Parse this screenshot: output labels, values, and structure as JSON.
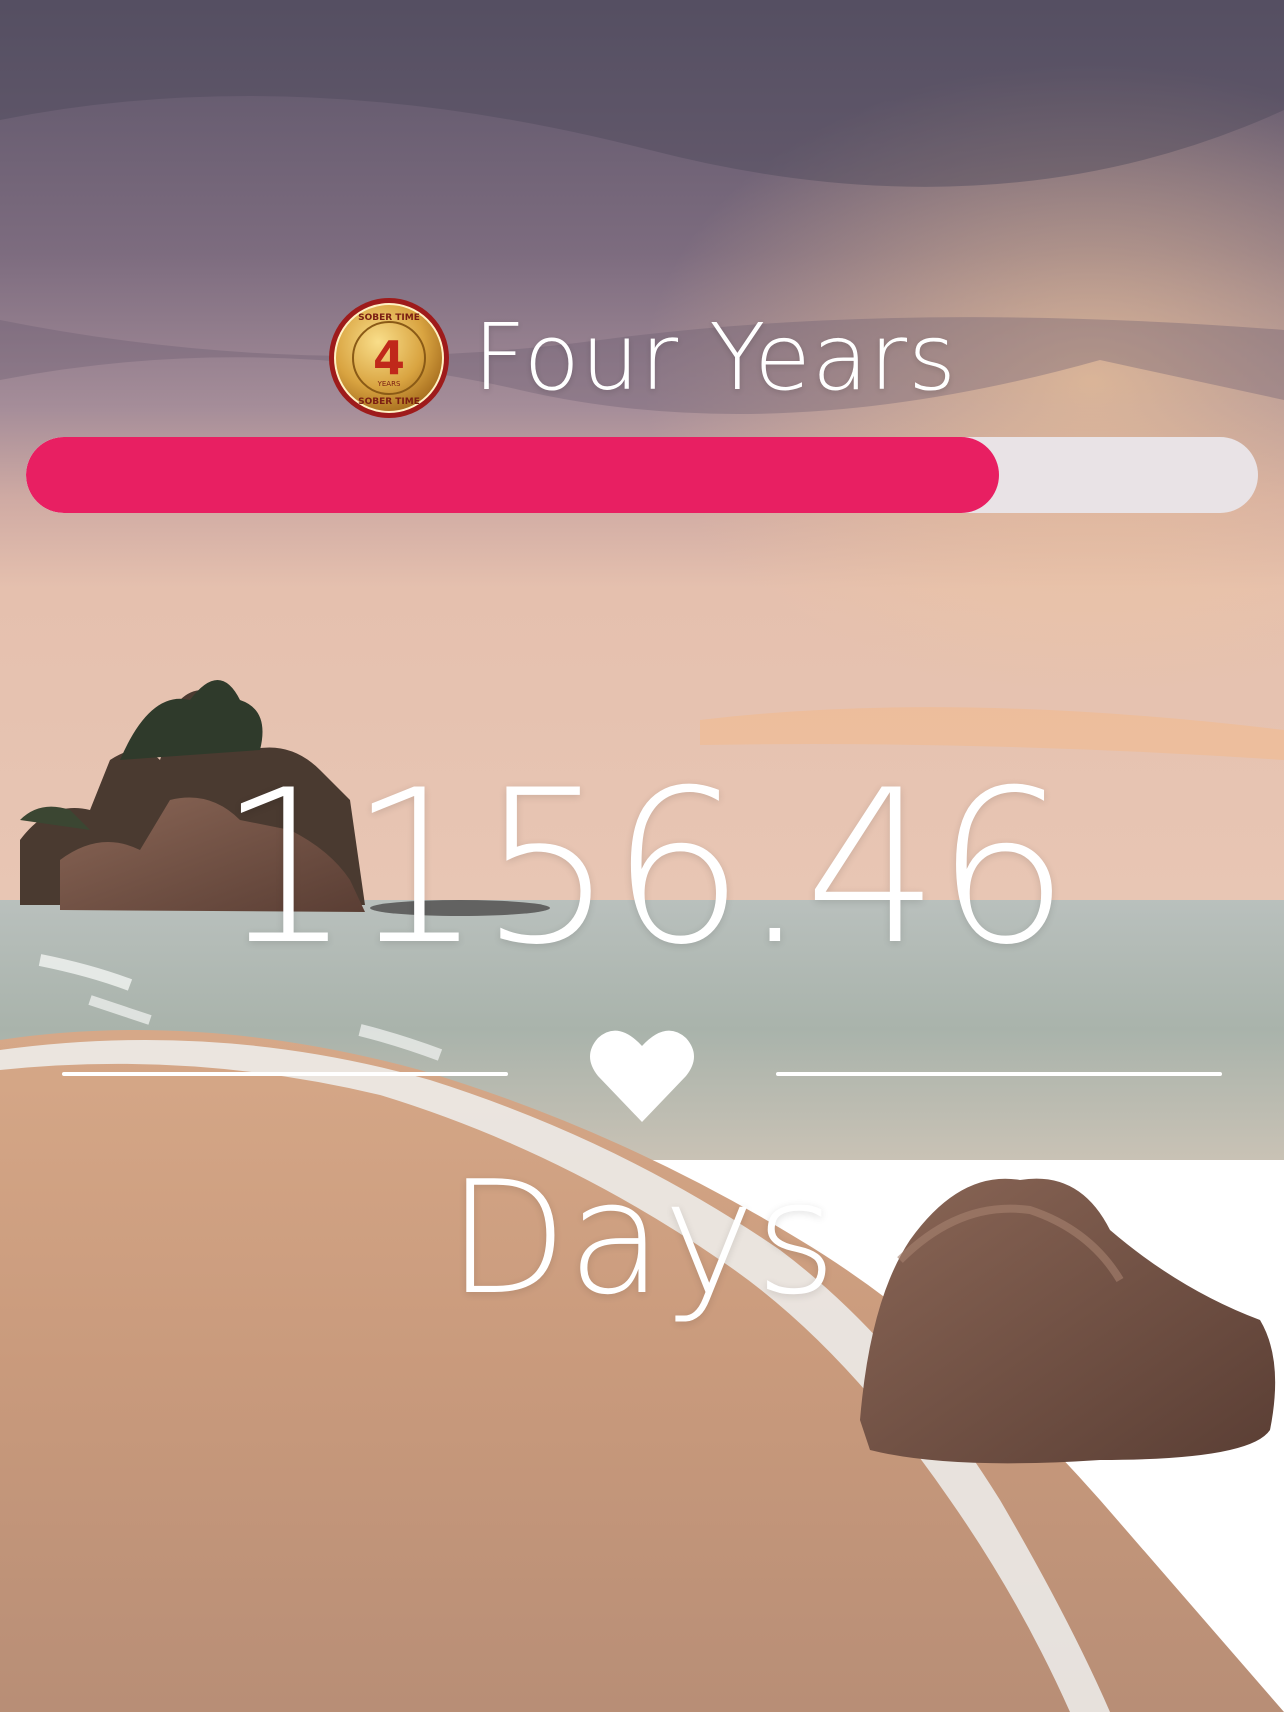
{
  "milestone": {
    "title": "Four Years",
    "badge": {
      "icon": "sober-time-medal-icon",
      "number": "4",
      "top_text": "SOBER TIME",
      "mid_text": "YEARS",
      "bottom_text": "SOBER TIME"
    }
  },
  "progress": {
    "fraction": 0.79,
    "fill_color": "#e81f62",
    "track_color": "#e9e3e6"
  },
  "counter": {
    "value": "1156.46",
    "unit": "Days"
  },
  "divider": {
    "icon": "heart-icon"
  }
}
